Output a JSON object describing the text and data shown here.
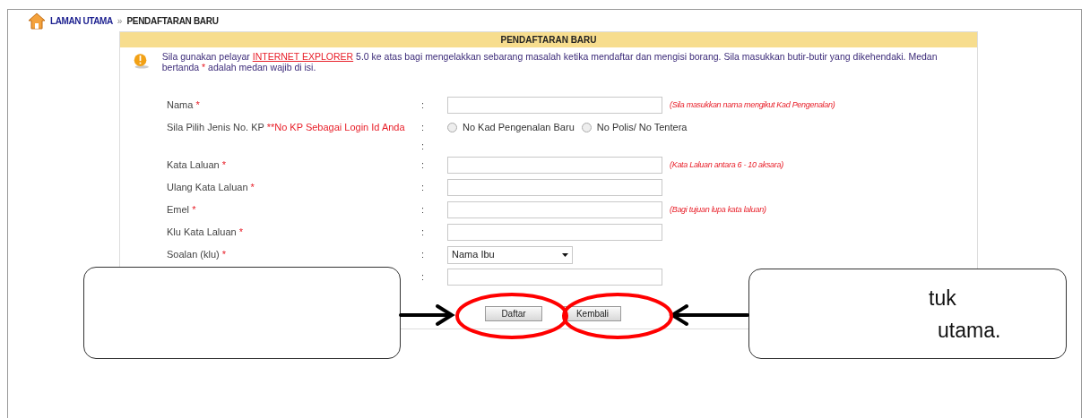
{
  "breadcrumb": {
    "home": "LAMAN UTAMA",
    "separator": "»",
    "current": "PENDAFTARAN BARU"
  },
  "panel": {
    "title": "PENDAFTARAN BARU",
    "message": {
      "before": "Sila gunakan pelayar ",
      "link": "INTERNET EXPLORER",
      "after": " 5.0 ke atas bagi mengelakkan sebarang masalah ketika mendaftar dan mengisi borang. Sila masukkan butir-butir yang dikehendaki. Medan bertanda ",
      "star": "*",
      "end": " adalah medan wajib di isi."
    },
    "rows": [
      {
        "label": "Nama",
        "star": "*",
        "kind": "text",
        "note": "(Sila masukkan nama mengikut Kad Pengenalan)"
      },
      {
        "label": "Sila Pilih Jenis No. KP",
        "label_note": "**No KP Sebagai Login Id Anda",
        "kind": "radio",
        "options": [
          {
            "label": "No Kad Pengenalan Baru",
            "selected": false
          },
          {
            "label": "No Polis/ No Tentera",
            "selected": false
          }
        ]
      },
      {
        "kind": "none"
      },
      {
        "label": "Kata Laluan",
        "star": "*",
        "kind": "text",
        "note": "(Kata Laluan antara 6 - 10 aksara)"
      },
      {
        "label": "Ulang Kata Laluan",
        "star": "*",
        "kind": "text"
      },
      {
        "label": "Emel",
        "star": "*",
        "kind": "text",
        "note": "(Bagi tujuan lupa kata laluan)"
      },
      {
        "label": "Klu Kata Laluan",
        "star": "*",
        "kind": "text"
      },
      {
        "label": "Soalan (klu)",
        "star": "*",
        "kind": "select",
        "value": "Nama Ibu"
      },
      {
        "kind": "text"
      }
    ],
    "colon": ":",
    "buttons": [
      "Daftar",
      "Kembali"
    ]
  },
  "callouts": [
    {
      "kind": "empty"
    },
    {
      "kind": "text",
      "lines": [
        "tuk",
        "utama."
      ]
    }
  ]
}
